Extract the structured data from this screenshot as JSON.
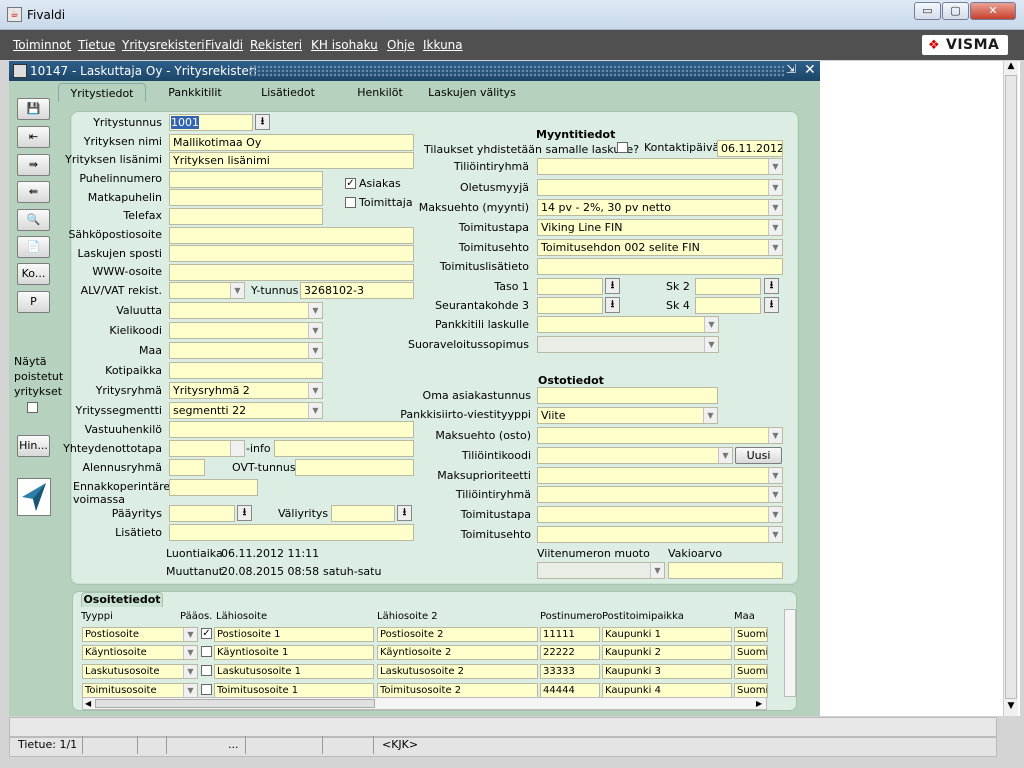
{
  "window": {
    "title": "Fivaldi",
    "minimize": "▭",
    "restore": "▢",
    "close": "✕"
  },
  "menu": {
    "items": [
      "Toiminnot",
      "Tietue",
      "Yritysrekisteri",
      "Fivaldi",
      "Rekisteri",
      "KH isohaku",
      "Ohje",
      "Ikkuna"
    ],
    "brand": "VISMA"
  },
  "inner": {
    "title": "10147 - Laskuttaja Oy - Yritysrekisteri",
    "close": "✕",
    "minimize": "⇲"
  },
  "toolbar": {
    "ko": "Ko...",
    "p": "P",
    "show_deleted": "Näytä poistetut yritykset",
    "hin": "Hin..."
  },
  "tabs": [
    "Yritystiedot",
    "Pankkitilit",
    "Lisätiedot",
    "Henkilöt",
    "Laskujen välitys"
  ],
  "left": {
    "yritystunnus": {
      "label": "Yritystunnus",
      "value": "1001"
    },
    "yrityksen_nimi": {
      "label": "Yrityksen nimi",
      "value": "Mallikotimaa Oy"
    },
    "lisanimi": {
      "label": "Yrityksen lisänimi",
      "value": "Yrityksen lisänimi"
    },
    "puhelin": {
      "label": "Puhelinnumero",
      "value": ""
    },
    "matkapuhelin": {
      "label": "Matkapuhelin",
      "value": ""
    },
    "telefax": {
      "label": "Telefax",
      "value": ""
    },
    "sahkoposti": {
      "label": "Sähköpostiosoite",
      "value": ""
    },
    "laskujen_sposti": {
      "label": "Laskujen sposti",
      "value": ""
    },
    "www": {
      "label": "WWW-osoite",
      "value": ""
    },
    "alv": {
      "label": "ALV/VAT rekist.",
      "value": ""
    },
    "ytunnus": {
      "label": "Y-tunnus",
      "value": "3268102-3"
    },
    "valuutta": {
      "label": "Valuutta",
      "value": ""
    },
    "kielikoodi": {
      "label": "Kielikoodi",
      "value": ""
    },
    "maa": {
      "label": "Maa",
      "value": ""
    },
    "kotipaikka": {
      "label": "Kotipaikka",
      "value": ""
    },
    "yritysryhma": {
      "label": "Yritysryhmä",
      "value": "Yritysryhmä 2"
    },
    "yrityssegmentti": {
      "label": "Yrityssegmentti",
      "value": "segmentti 22"
    },
    "vastuuhenkilo": {
      "label": "Vastuuhenkilö",
      "value": ""
    },
    "yhteydenottotapa": {
      "label": "Yhteydenottotapa",
      "value": "",
      "info_label": "-info",
      "info": ""
    },
    "alennusryhma": {
      "label": "Alennusryhmä",
      "value": ""
    },
    "ovt": {
      "label": "OVT-tunnus",
      "value": ""
    },
    "ennakko": {
      "label": "Ennakkoperintärek. voimassa",
      "value": ""
    },
    "paayritys": {
      "label": "Pääyritys",
      "value": ""
    },
    "valiyritys": {
      "label": "Väliyritys",
      "value": ""
    },
    "lisatieto": {
      "label": "Lisätieto",
      "value": ""
    },
    "asiakas": {
      "label": "Asiakas",
      "checked": true
    },
    "toimittaja": {
      "label": "Toimittaja",
      "checked": false
    },
    "luontiaika": {
      "label": "Luontiaika",
      "value": "06.11.2012 11:11"
    },
    "muuttanut": {
      "label": "Muuttanut",
      "value": "20.08.2015 08:58",
      "user": "satuh-satu"
    }
  },
  "myynti": {
    "heading": "Myyntitiedot",
    "yhdistetaan": {
      "label": "Tilaukset yhdistetään samalle laskulle?",
      "checked": false
    },
    "kontaktipaiva": {
      "label": "Kontaktipäivä",
      "value": "06.11.2012"
    },
    "tiliointiryhma": {
      "label": "Tiliöintiryhmä",
      "value": ""
    },
    "oletusmyyja": {
      "label": "Oletusmyyjä",
      "value": ""
    },
    "maksuehto": {
      "label": "Maksuehto (myynti)",
      "value": "14 pv - 2%, 30 pv netto"
    },
    "toimitustapa": {
      "label": "Toimitustapa",
      "value": "Viking Line FIN"
    },
    "toimitusehto": {
      "label": "Toimitusehto",
      "value": "Toimitusehdon 002 selite FIN"
    },
    "toimituslisatieto": {
      "label": "Toimituslisätieto",
      "value": ""
    },
    "taso1": {
      "label": "Taso 1",
      "value": ""
    },
    "sk2": {
      "label": "Sk 2",
      "value": ""
    },
    "seuranta3": {
      "label": "Seurantakohde 3",
      "value": ""
    },
    "sk4": {
      "label": "Sk 4",
      "value": ""
    },
    "pankkitili": {
      "label": "Pankkitili laskulle",
      "value": ""
    },
    "suoraveloitus": {
      "label": "Suoraveloitussopimus",
      "value": ""
    }
  },
  "osto": {
    "heading": "Ostotiedot",
    "oma_asiakastunnus": {
      "label": "Oma asiakastunnus",
      "value": ""
    },
    "viestityyppi": {
      "label": "Pankkisiirto-viestityyppi",
      "value": "Viite"
    },
    "maksuehto": {
      "label": "Maksuehto (osto)",
      "value": ""
    },
    "tiliointikoodi": {
      "label": "Tiliöintikoodi",
      "value": "",
      "button": "Uusi"
    },
    "maksuprioriteetti": {
      "label": "Maksuprioriteetti",
      "value": ""
    },
    "tiliointiryhma": {
      "label": "Tiliöintiryhmä",
      "value": ""
    },
    "toimitustapa": {
      "label": "Toimitustapa",
      "value": ""
    },
    "toimitusehto": {
      "label": "Toimitusehto",
      "value": ""
    },
    "viitenumero_label": "Viitenumeron muoto",
    "vakioarvo_label": "Vakioarvo"
  },
  "addresses": {
    "tab": "Osoitetiedot",
    "columns": [
      "Tyyppi",
      "Pääos.",
      "Lähiosoite",
      "Lähiosoite 2",
      "Postinumero",
      "Postitoimipaikka",
      "Maa"
    ],
    "rows": [
      {
        "tyyppi": "Postiosoite",
        "paa": true,
        "lahi": "Postiosoite 1",
        "lahi2": "Postiosoite 2",
        "postinro": "11111",
        "ptp": "Kaupunki 1",
        "maa": "Suomi"
      },
      {
        "tyyppi": "Käyntiosoite",
        "paa": false,
        "lahi": "Käyntiosoite 1",
        "lahi2": "Käyntiosoite 2",
        "postinro": "22222",
        "ptp": "Kaupunki 2",
        "maa": "Suomi"
      },
      {
        "tyyppi": "Laskutusosoite",
        "paa": false,
        "lahi": "Laskutusosoite 1",
        "lahi2": "Laskutusosoite 2",
        "postinro": "33333",
        "ptp": "Kaupunki 3",
        "maa": "Suomi"
      },
      {
        "tyyppi": "Toimitusosoite",
        "paa": false,
        "lahi": "Toimitusosoite 1",
        "lahi2": "Toimitusosoite 2",
        "postinro": "44444",
        "ptp": "Kaupunki 4",
        "maa": "Suomi"
      }
    ]
  },
  "status": {
    "record": "Tietue: 1/1",
    "s2": "...",
    "s3": "<KJK>"
  }
}
